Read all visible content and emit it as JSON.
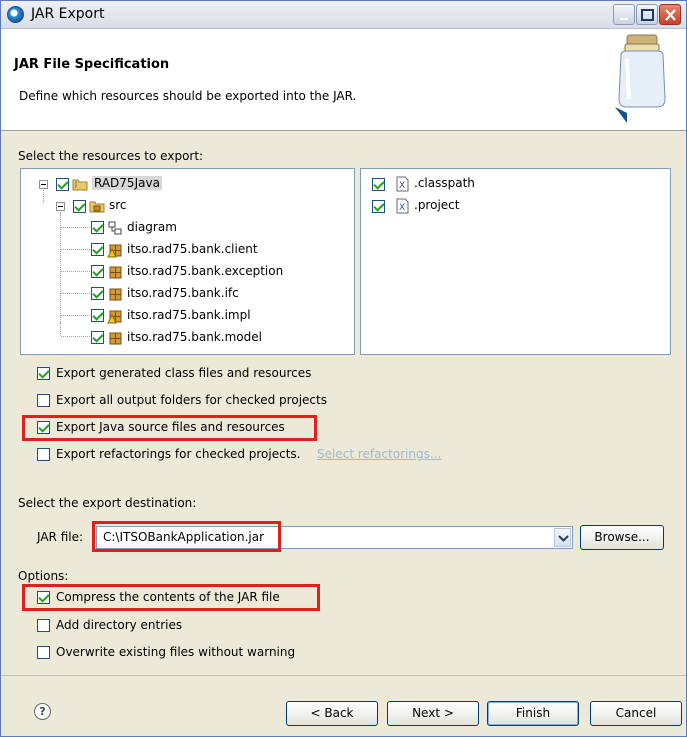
{
  "window": {
    "title": "JAR Export"
  },
  "banner": {
    "title": "JAR File Specification",
    "description": "Define which resources should be exported into the JAR."
  },
  "resources": {
    "label": "Select the resources to export:",
    "tree": {
      "root": {
        "label": "RAD75Java",
        "checked": true
      },
      "src": {
        "label": "src",
        "checked": true
      },
      "children": [
        {
          "label": "diagram",
          "checked": true,
          "icon": "diagram-icon"
        },
        {
          "label": "itso.rad75.bank.client",
          "checked": true,
          "icon": "package-warning-icon"
        },
        {
          "label": "itso.rad75.bank.exception",
          "checked": true,
          "icon": "package-icon"
        },
        {
          "label": "itso.rad75.bank.ifc",
          "checked": true,
          "icon": "package-icon"
        },
        {
          "label": "itso.rad75.bank.impl",
          "checked": true,
          "icon": "package-warning-icon"
        },
        {
          "label": "itso.rad75.bank.model",
          "checked": true,
          "icon": "package-icon"
        }
      ]
    },
    "files": [
      {
        "label": ".classpath",
        "checked": true
      },
      {
        "label": ".project",
        "checked": true
      }
    ]
  },
  "export_options": {
    "generated": {
      "label": "Export generated class files and resources",
      "checked": true
    },
    "output_folders": {
      "label": "Export all output folders for checked projects",
      "checked": false
    },
    "java_source": {
      "label": "Export Java source files and resources",
      "checked": true
    },
    "refactorings": {
      "label": "Export refactorings for checked projects.",
      "checked": false,
      "link": "Select refactorings..."
    }
  },
  "destination": {
    "label": "Select the export destination:",
    "jar_file_label": "JAR file:",
    "jar_file_value": "C:\\ITSOBankApplication.jar",
    "browse_label": "Browse..."
  },
  "options": {
    "label": "Options:",
    "compress": {
      "label": "Compress the contents of the JAR file",
      "checked": true
    },
    "directory_entries": {
      "label": "Add directory entries",
      "checked": false
    },
    "overwrite": {
      "label": "Overwrite existing files without warning",
      "checked": false
    }
  },
  "buttons": {
    "help": "?",
    "back": "< Back",
    "next": "Next >",
    "finish": "Finish",
    "cancel": "Cancel"
  },
  "colors": {
    "highlight": "#e0201c",
    "check": "#21a121"
  }
}
